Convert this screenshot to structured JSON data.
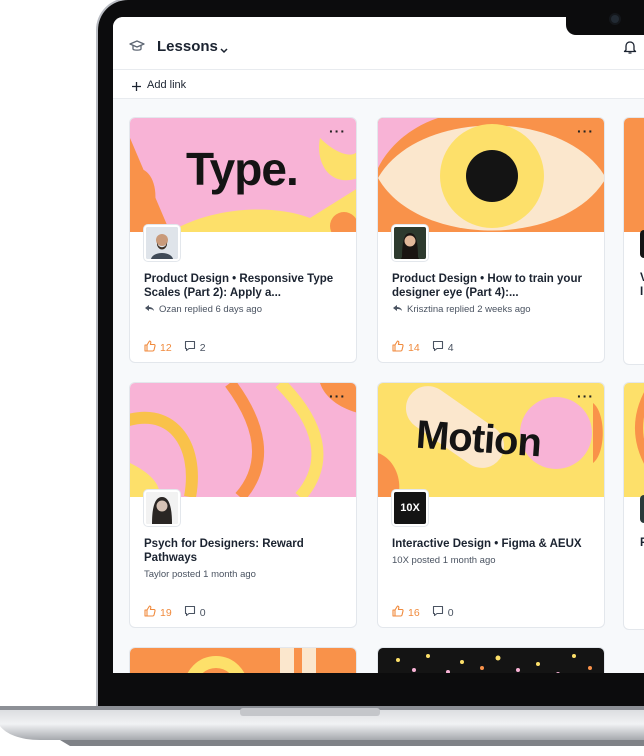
{
  "header": {
    "title": "Lessons",
    "add_link_label": "Add link"
  },
  "lessons": [
    {
      "banner_text": "Type.",
      "title": "Product Design • Responsive Type Scales (Part 2): Apply a...",
      "meta": "Ozan replied 6 days ago",
      "likes": "12",
      "comments": "2"
    },
    {
      "banner_text": "",
      "title": "Product Design • How to train your designer eye (Part 4):...",
      "meta": "Krisztina replied 2 weeks ago",
      "likes": "14",
      "comments": "4"
    },
    {
      "banner_text": "",
      "title": "Psych for Designers: Reward Pathways",
      "meta": "Taylor posted 1 month ago",
      "likes": "19",
      "comments": "0"
    },
    {
      "banner_text": "Motion",
      "avatar_text": "10X",
      "title": "Interactive Design • Figma & AEUX",
      "meta": "10X posted 1 month ago",
      "likes": "16",
      "comments": "0"
    }
  ],
  "partial_column_letters": [
    "V",
    "I",
    "P"
  ],
  "colors": {
    "accent_orange": "#f08a3c",
    "banner_pink": "#f8b3d6",
    "banner_yellow": "#fde06a",
    "banner_orange": "#f9924a"
  },
  "icons": [
    "graduation-cap-icon",
    "chevron-down-icon",
    "bell-icon",
    "plus-icon",
    "more-icon",
    "reply-arrow-icon",
    "thumbs-up-icon",
    "comment-icon"
  ]
}
